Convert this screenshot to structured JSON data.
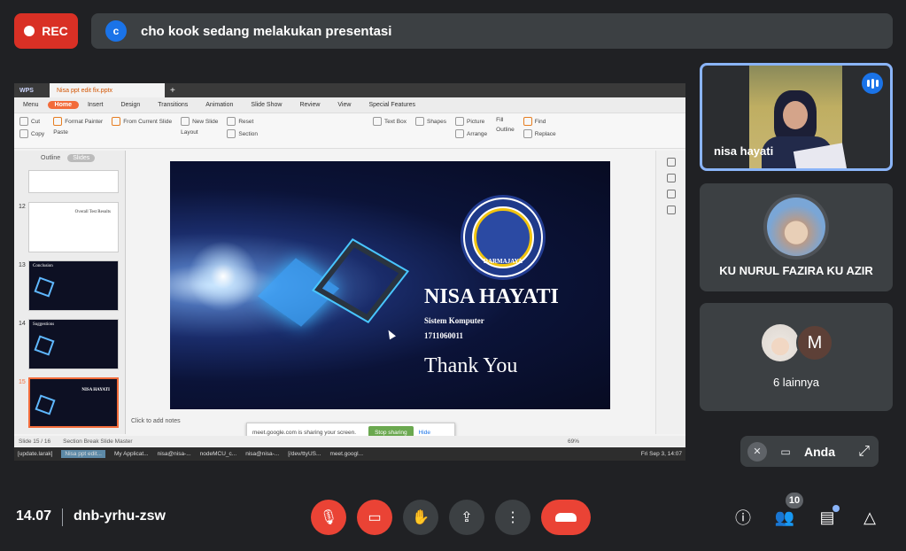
{
  "top": {
    "rec_label": "REC",
    "presenter_initial": "c",
    "banner_text": "cho kook sedang melakukan presentasi"
  },
  "presentation": {
    "app_name": "WPS",
    "file_tab": "Nisa ppt edit fix.pptx",
    "menu": [
      "Menu",
      "Home",
      "Insert",
      "Design",
      "Transitions",
      "Animation",
      "Slide Show",
      "Review",
      "View",
      "Special Features"
    ],
    "ribbon": {
      "paste": "Paste",
      "cut": "Cut",
      "copy": "Copy",
      "format_painter": "Format Painter",
      "from_current_slide": "From Current Slide",
      "new_slide": "New Slide",
      "layout": "Layout",
      "reset": "Reset",
      "section": "Section",
      "text_box": "Text Box",
      "shapes": "Shapes",
      "picture": "Picture",
      "arrange": "Arrange",
      "fill": "Fill",
      "outline": "Outline",
      "find": "Find",
      "replace": "Replace"
    },
    "pane_tabs": [
      "Outline",
      "Slides"
    ],
    "thumbnails": [
      {
        "num": "12",
        "title": "Overall Test Results"
      },
      {
        "num": "13",
        "title": "Conclusion"
      },
      {
        "num": "14",
        "title": "Suggestions"
      },
      {
        "num": "15",
        "title": "NISA HAYATI"
      }
    ],
    "slide": {
      "logo_text": "DARMAJAYA",
      "name": "NISA HAYATI",
      "program": "Sistem Komputer",
      "student_id": "1711060011",
      "thanks": "Thank You"
    },
    "notes_placeholder": "Click to add notes",
    "share_bar": {
      "text": "meet.google.com is sharing your screen.",
      "stop": "Stop sharing",
      "hide": "Hide"
    },
    "status": {
      "slide_count": "Slide 15 / 16",
      "master": "Section Break Slide Master",
      "zoom": "69%"
    },
    "taskbar": {
      "items": [
        "[update.larak]",
        "Nisa ppt edit...",
        "My Applicat...",
        "nisa@nisa-...",
        "nodeMCU_c...",
        "nisa@nisa-...",
        "[/dev/ttyUS...",
        "meet.googl..."
      ],
      "clock": "Fri Sep  3, 14:07"
    }
  },
  "participants": {
    "speaker_name": "nisa hayati",
    "tile2_name": "KU NURUL FAZIRA KU AZIR",
    "tile3_more": "6 lainnya",
    "tile3_initial": "M",
    "self_label": "Anda"
  },
  "bottom": {
    "time": "14.07",
    "meeting_code": "dnb-yrhu-zsw",
    "participant_count": "10"
  },
  "colors": {
    "background": "#202124",
    "danger": "#ea4335",
    "accent_blue": "#8ab4f8",
    "wps_orange": "#f26b3a"
  }
}
